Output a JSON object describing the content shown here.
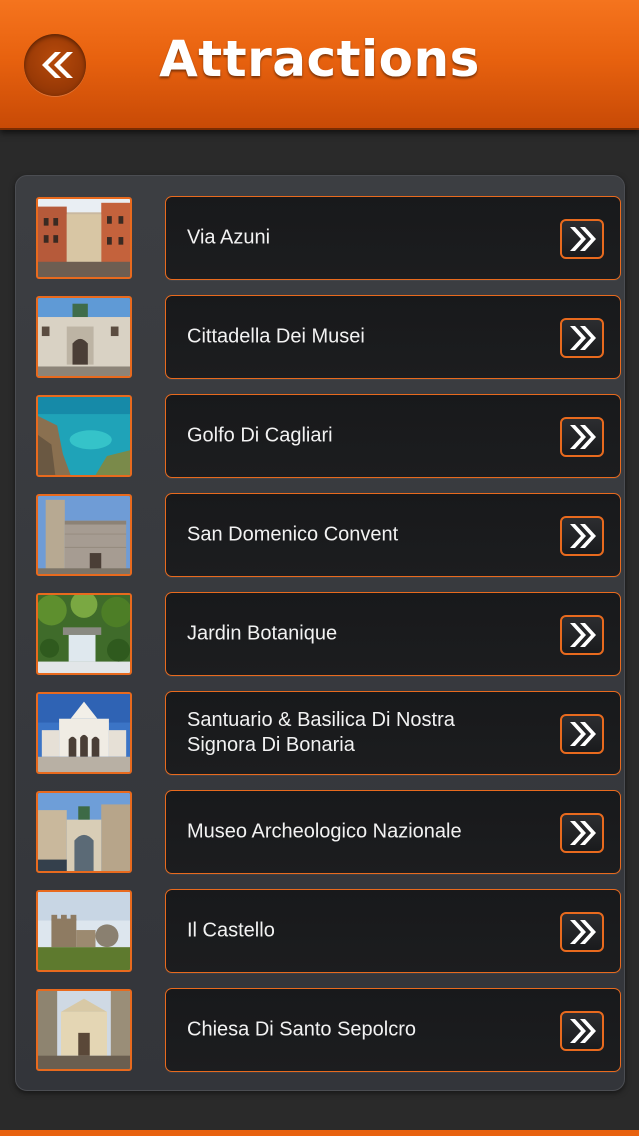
{
  "header": {
    "title": "Attractions",
    "back_icon": "double-chevron-left-icon"
  },
  "colors": {
    "accent": "#e86a1e",
    "header_orange": "#f5741e",
    "background": "#2a2a2a",
    "card": "#1a1b1d",
    "text": "#f2f2f2"
  },
  "attractions": [
    {
      "name": "Via Azuni",
      "thumb": "street-photo"
    },
    {
      "name": "Cittadella Dei Musei",
      "thumb": "gate-building-photo"
    },
    {
      "name": "Golfo Di Cagliari",
      "thumb": "coastline-photo"
    },
    {
      "name": "San Domenico Convent",
      "thumb": "convent-tower-photo"
    },
    {
      "name": "Jardin Botanique",
      "thumb": "garden-waterfall-photo"
    },
    {
      "name": "Santuario & Basilica Di Nostra Signora Di Bonaria",
      "thumb": "basilica-photo"
    },
    {
      "name": "Museo Archeologico Nazionale",
      "thumb": "museum-arch-photo"
    },
    {
      "name": "Il Castello",
      "thumb": "castle-tower-photo"
    },
    {
      "name": "Chiesa Di Santo Sepolcro",
      "thumb": "church-facade-photo"
    }
  ],
  "row_action_icon": "double-chevron-right-icon"
}
